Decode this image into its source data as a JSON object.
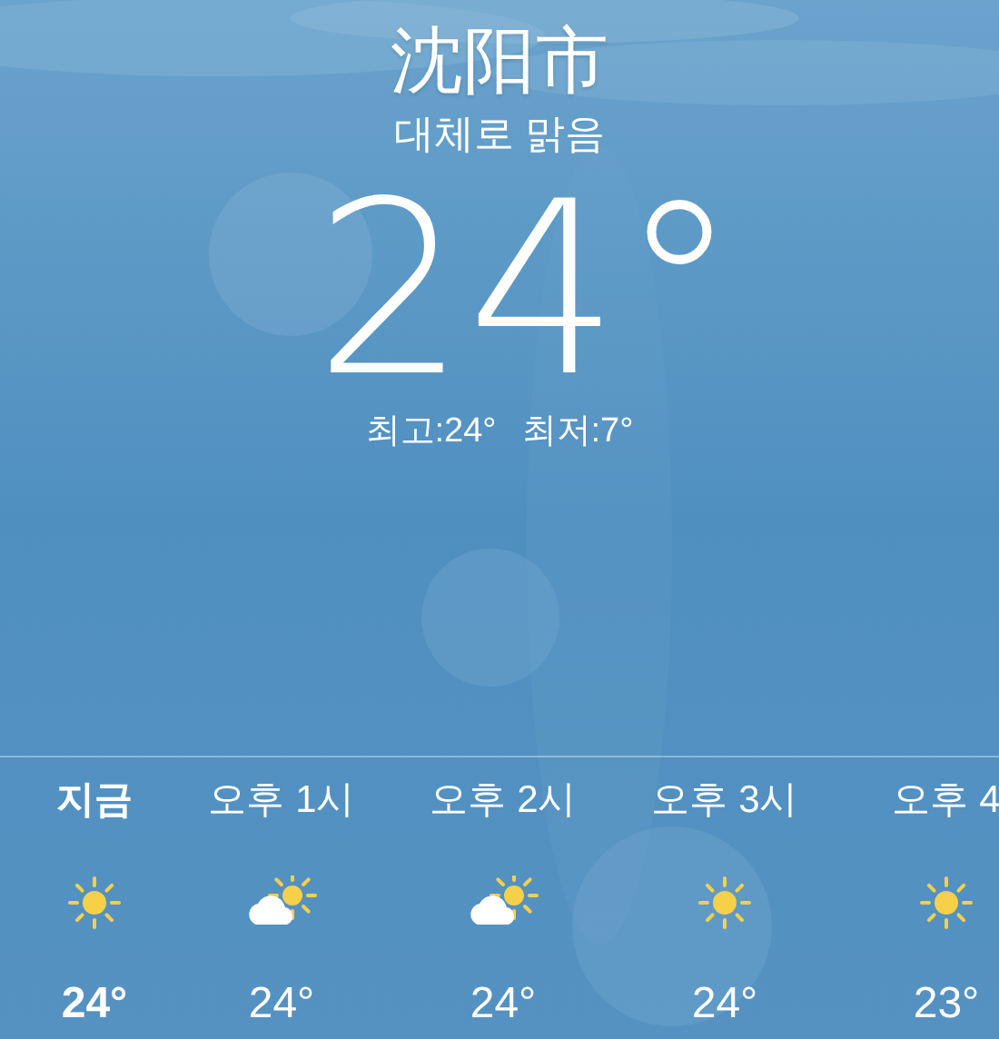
{
  "location": {
    "city": "沈阳市",
    "condition": "대체로 맑음",
    "temperature": "24°",
    "high": "최고:24°",
    "low": "최저:7°"
  },
  "hourly": [
    {
      "time": "지금",
      "kind": "sun",
      "temperature": "24°",
      "current": true
    },
    {
      "time": "오후 1시",
      "kind": "partly-cloudy",
      "temperature": "24°",
      "current": false
    },
    {
      "time": "오후 2시",
      "kind": "partly-cloudy",
      "temperature": "24°",
      "current": false
    },
    {
      "time": "오후 3시",
      "kind": "sun",
      "temperature": "24°",
      "current": false
    },
    {
      "time": "오후 4",
      "kind": "sun",
      "temperature": "23°",
      "current": false
    }
  ]
}
